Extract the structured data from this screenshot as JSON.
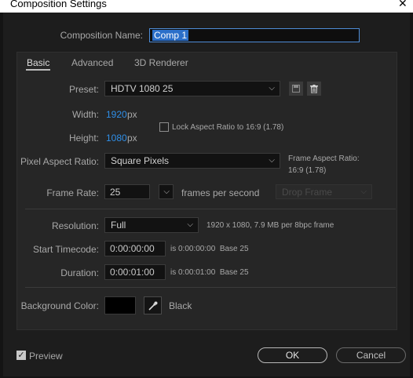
{
  "window": {
    "title": "Composition Settings",
    "close_glyph": "✕"
  },
  "comp_name": {
    "label": "Composition Name:",
    "value": "Comp 1"
  },
  "tabs": [
    {
      "label": "Basic",
      "active": true
    },
    {
      "label": "Advanced",
      "active": false
    },
    {
      "label": "3D Renderer",
      "active": false
    }
  ],
  "preset": {
    "label": "Preset:",
    "value": "HDTV 1080 25",
    "save_icon": "save-preset-icon",
    "delete_icon": "trash-icon"
  },
  "width": {
    "label": "Width:",
    "value": "1920",
    "unit": "px"
  },
  "height": {
    "label": "Height:",
    "value": "1080",
    "unit": "px"
  },
  "lock_aspect": {
    "label": "Lock Aspect Ratio to 16:9 (1.78)",
    "checked": false
  },
  "pixel_aspect": {
    "label": "Pixel Aspect Ratio:",
    "value": "Square Pixels"
  },
  "frame_aspect": {
    "label": "Frame Aspect Ratio:",
    "value": "16:9 (1.78)"
  },
  "frame_rate": {
    "label": "Frame Rate:",
    "value": "25",
    "suffix": "frames per second",
    "drop_frame": "Drop Frame"
  },
  "resolution": {
    "label": "Resolution:",
    "value": "Full",
    "info": "1920 x 1080, 7.9 MB per 8bpc frame"
  },
  "start_timecode": {
    "label": "Start Timecode:",
    "value": "0:00:00:00",
    "info": "is 0:00:00:00  Base 25"
  },
  "duration": {
    "label": "Duration:",
    "value": "0:00:01:00",
    "info": "is 0:00:01:00  Base 25"
  },
  "background": {
    "label": "Background Color:",
    "swatch_color": "#000000",
    "color_name": "Black"
  },
  "footer": {
    "preview_label": "Preview",
    "preview_checked": true,
    "ok_label": "OK",
    "cancel_label": "Cancel"
  },
  "colors": {
    "accent": "#2f8fe8",
    "panel": "#262626",
    "background": "#1d1d1d"
  }
}
